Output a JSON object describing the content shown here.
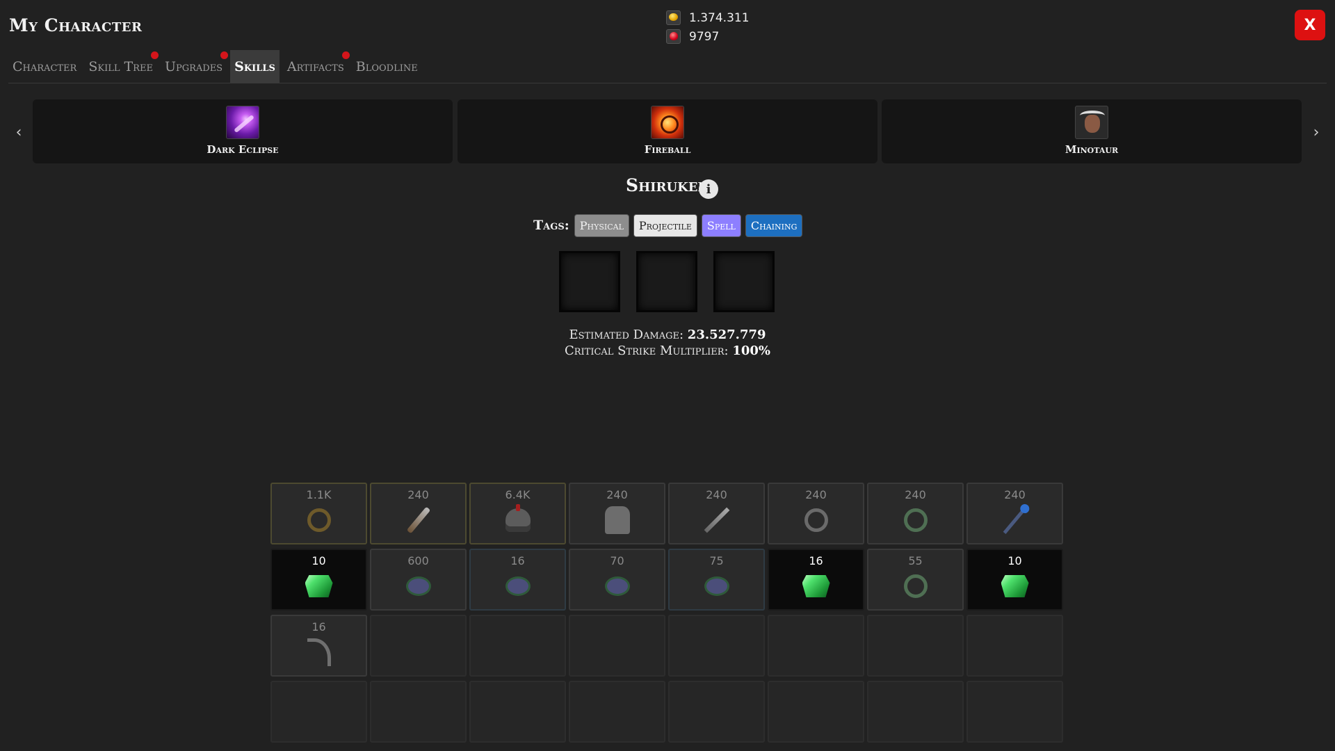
{
  "header": {
    "title": "My Character",
    "gold": "1.374.311",
    "gems": "9797",
    "close_label": "X"
  },
  "tabs": [
    {
      "label": "Character",
      "active": false,
      "notify": false
    },
    {
      "label": "Skill Tree",
      "active": false,
      "notify": true
    },
    {
      "label": "Upgrades",
      "active": false,
      "notify": true
    },
    {
      "label": "Skills",
      "active": true,
      "notify": false
    },
    {
      "label": "Artifacts",
      "active": false,
      "notify": true
    },
    {
      "label": "Bloodline",
      "active": false,
      "notify": false
    }
  ],
  "skills": [
    {
      "label": "Dark Eclipse",
      "icon": "dark-eclipse-icon"
    },
    {
      "label": "Fireball",
      "icon": "fireball-icon"
    },
    {
      "label": "Minotaur",
      "icon": "minotaur-icon"
    }
  ],
  "selected_skill": {
    "name": "Shiruken",
    "tags_label": "Tags:",
    "tags": [
      "Physical",
      "Projectile",
      "Spell",
      "Chaining"
    ],
    "estimated_damage_label": "Estimated Damage:",
    "estimated_damage": "23.527.779",
    "crit_label": "Critical Strike Multiplier:",
    "crit_value": "100%"
  },
  "inventory": [
    {
      "qty": "1.1K",
      "icon": "ring-icon",
      "style": "gold"
    },
    {
      "qty": "240",
      "icon": "dagger-icon",
      "style": "gold"
    },
    {
      "qty": "6.4K",
      "icon": "helmet-icon",
      "style": "gold"
    },
    {
      "qty": "240",
      "icon": "armor-icon",
      "style": "normal"
    },
    {
      "qty": "240",
      "icon": "sword-icon",
      "style": "normal"
    },
    {
      "qty": "240",
      "icon": "ring-icon",
      "style": "normal"
    },
    {
      "qty": "240",
      "icon": "ring-icon",
      "style": "normal"
    },
    {
      "qty": "240",
      "icon": "staff-icon",
      "style": "normal"
    },
    {
      "qty": "10",
      "icon": "emerald-icon",
      "style": "highlight"
    },
    {
      "qty": "600",
      "icon": "spider-icon",
      "style": "normal"
    },
    {
      "qty": "16",
      "icon": "spider-icon",
      "style": "blueish"
    },
    {
      "qty": "70",
      "icon": "spider-icon",
      "style": "normal"
    },
    {
      "qty": "75",
      "icon": "spider-icon",
      "style": "blueish"
    },
    {
      "qty": "16",
      "icon": "emerald-icon",
      "style": "highlight"
    },
    {
      "qty": "55",
      "icon": "ring-icon",
      "style": "normal"
    },
    {
      "qty": "10",
      "icon": "emerald-icon",
      "style": "highlight"
    },
    {
      "qty": "16",
      "icon": "scythe-icon",
      "style": "normal"
    }
  ]
}
